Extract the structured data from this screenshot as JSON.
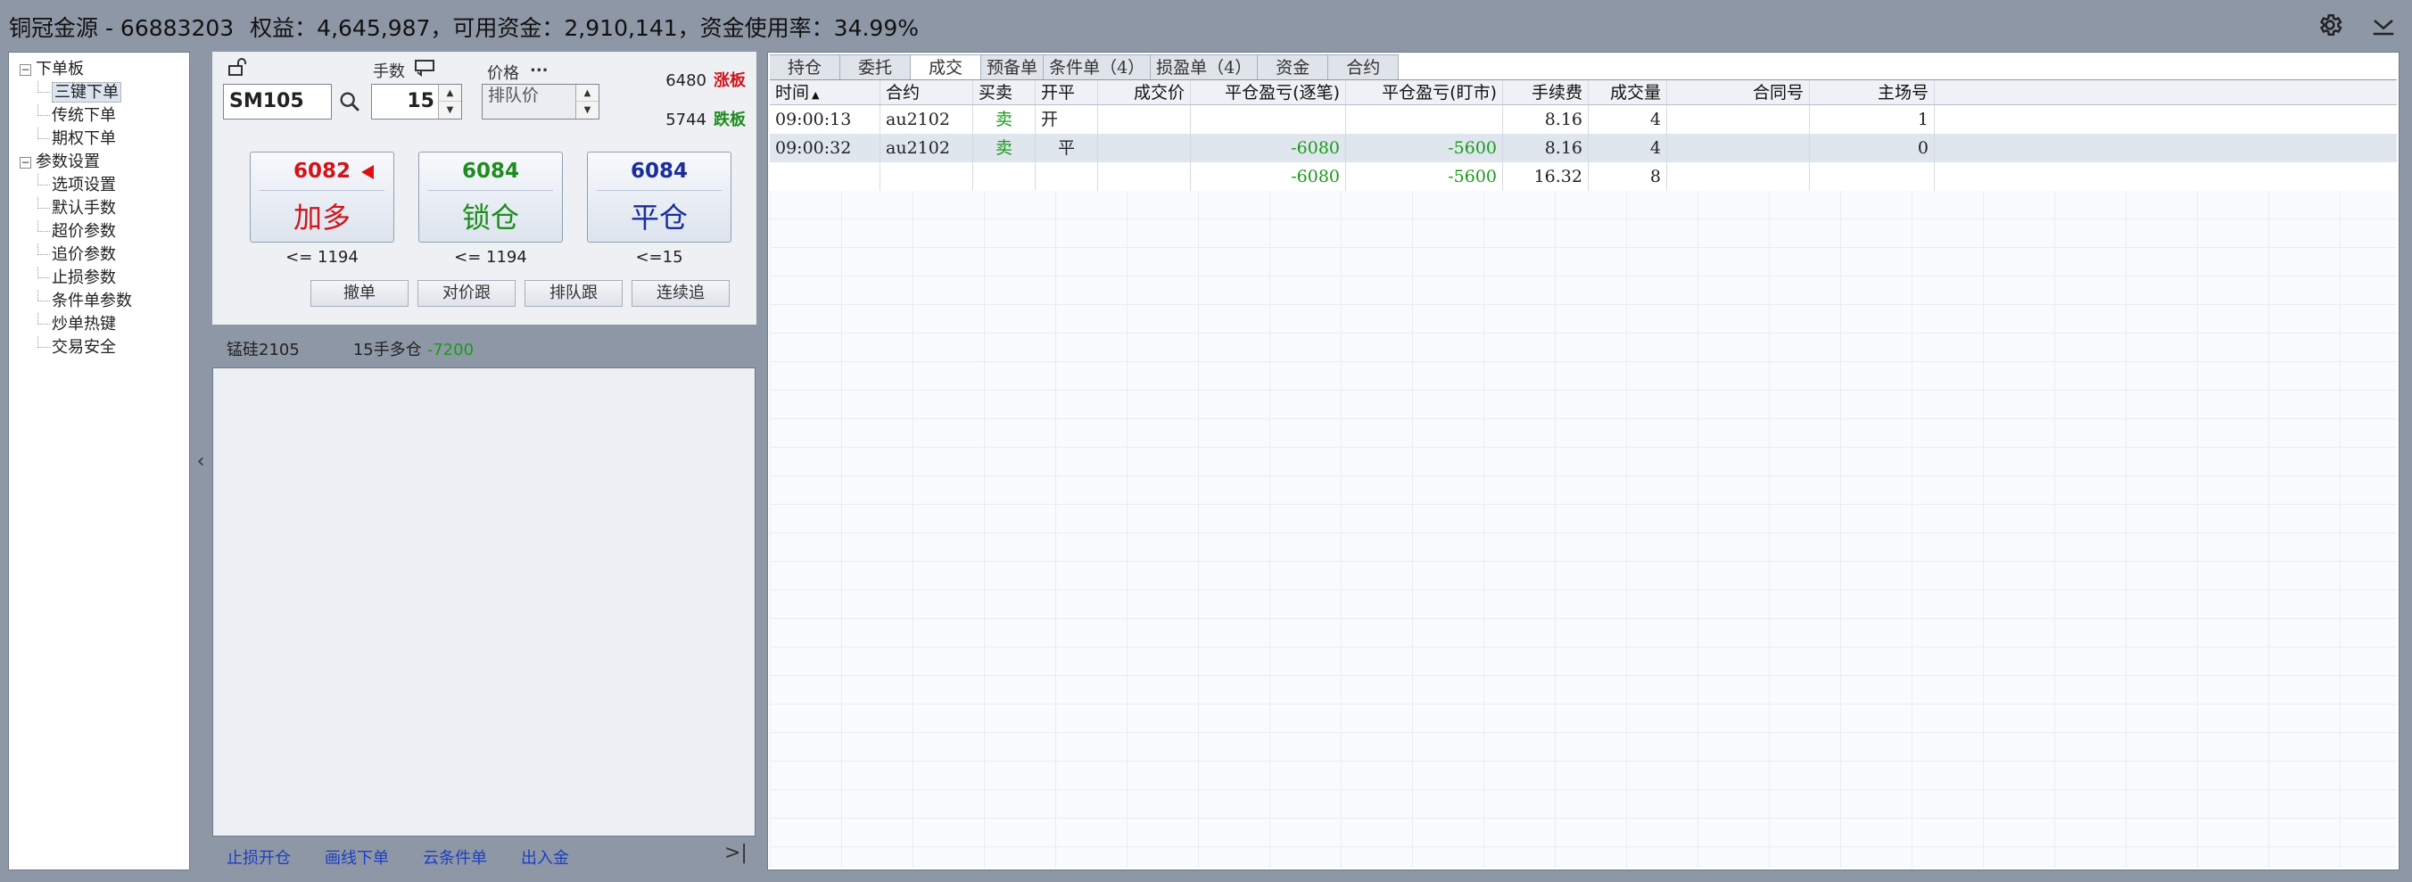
{
  "titlebar": {
    "account": "铜冠金源 - 66883203",
    "equity": "权益：4,645,987，",
    "available": "可用资金：2,910,141，",
    "usage": "资金使用率：34.99%",
    "icons": [
      "gear-icon",
      "minimize-down-icon"
    ]
  },
  "nav": {
    "groups": [
      {
        "label": "下单板",
        "toggle": "⊟",
        "items": [
          "三键下单",
          "传统下单",
          "期权下单"
        ]
      },
      {
        "label": "参数设置",
        "toggle": "⊟",
        "items": [
          "选项设置",
          "默认手数",
          "超价参数",
          "追价参数",
          "止损参数",
          "条件单参数",
          "炒单热键",
          "交易安全"
        ]
      }
    ],
    "selected": "三键下单"
  },
  "order": {
    "symbol": "SM105",
    "qty_label": "手数",
    "qty": "15",
    "price_label": "价格",
    "price_more": "...",
    "price_value": "排队价",
    "limit_up_price": "6480",
    "limit_up_label": "涨板",
    "limit_down_price": "5744",
    "limit_down_label": "跌板",
    "buttons": [
      {
        "price": "6082",
        "label": "加多",
        "note": "<= 1194",
        "color": "#d0151b"
      },
      {
        "price": "6084",
        "label": "锁仓",
        "note": "<= 1194",
        "color": "#1e8c1e"
      },
      {
        "price": "6084",
        "label": "平仓",
        "note": "<=15",
        "color": "#1a2d9c"
      }
    ],
    "small_buttons": [
      "撤单",
      "对价跟",
      "排队跟",
      "连续追"
    ]
  },
  "position": {
    "contract": "锰硅2105",
    "desc": "15手多仓",
    "pnl": "-7200"
  },
  "bottom_links": [
    "止损开仓",
    "画线下单",
    "云条件单",
    "出入金"
  ],
  "tabs": [
    "持仓",
    "委托",
    "成交",
    "预备单",
    "条件单（4）",
    "损盈单（4）",
    "资金",
    "合约"
  ],
  "active_tab": "成交",
  "grid": {
    "columns": [
      "时间",
      "合约",
      "买卖",
      "开平",
      "成交价",
      "平仓盈亏(逐笔)",
      "平仓盈亏(盯市)",
      "手续费",
      "成交量",
      "合同号",
      "主场号"
    ],
    "sort_column": "时间",
    "rows": [
      [
        "09:00:13",
        "au2102",
        "卖",
        "开",
        "",
        "",
        "",
        "8.16",
        "4",
        "",
        "1"
      ],
      [
        "09:00:32",
        "au2102",
        "卖",
        "平",
        "",
        "-6080",
        "-5600",
        "8.16",
        "4",
        "",
        "0"
      ],
      [
        "",
        "",
        "",
        "",
        "",
        "-6080",
        "-5600",
        "16.32",
        "8",
        "",
        ""
      ]
    ]
  }
}
